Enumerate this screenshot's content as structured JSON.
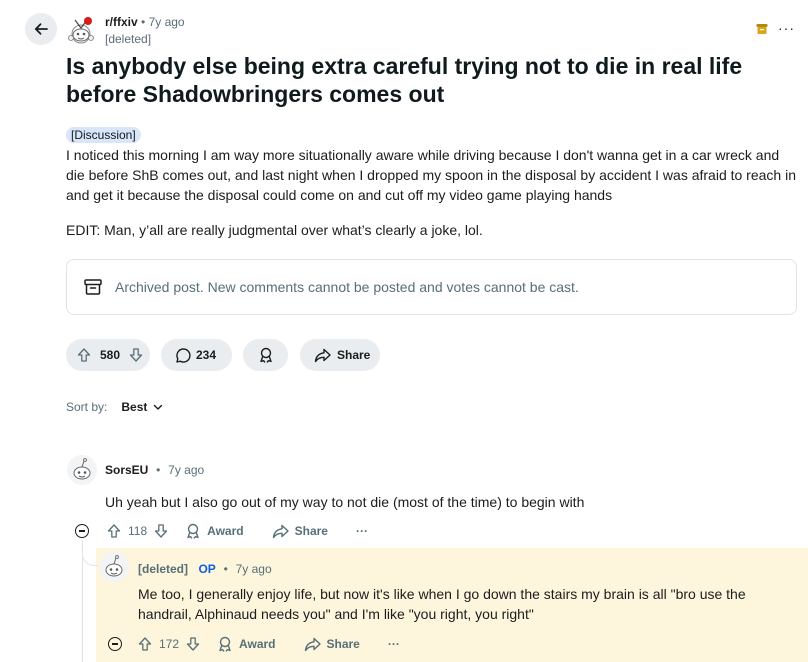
{
  "post": {
    "subreddit": "r/ffxiv",
    "time": "7y ago",
    "author": "[deleted]",
    "title": "Is anybody else being extra careful trying not to die in real life before Shadowbringers comes out",
    "flair": "[Discussion]",
    "body": "I noticed this morning I am way more situationally aware while driving because I don't wanna get in a car wreck and die before ShB comes out, and last night when I dropped my spoon in the disposal by accident I was afraid to reach in and get it because the disposal could come on and cut off my video game playing hands",
    "edit": "EDIT: Man, y’all are really judgmental over what’s clearly a joke, lol.",
    "archived_notice": "Archived post. New comments cannot be posted and votes cannot be cast.",
    "more_label": "···",
    "votes": "580",
    "comments": "234",
    "share_label": "Share"
  },
  "sort": {
    "label": "Sort by:",
    "value": "Best"
  },
  "comments": [
    {
      "author": "SorsEU",
      "time": "7y ago",
      "body": "Uh yeah but I also go out of my way to not die (most of the time) to begin with",
      "votes": "118",
      "award_label": "Award",
      "share_label": "Share",
      "more_label": "···"
    },
    {
      "author": "[deleted]",
      "op_badge": "OP",
      "time": "7y ago",
      "body_line1": "Me too, I generally enjoy life, but now it's like when I go down the stairs my brain is all \"bro use the",
      "body_line2": "handrail, Alphinaud needs you\" and I'm like \"you right, you right\"",
      "votes": "172",
      "award_label": "Award",
      "share_label": "Share",
      "more_label": "···"
    }
  ],
  "colors": {
    "highlight": "#fdf6dd",
    "op": "#0a5fde",
    "flair": "#d9e5f8"
  }
}
